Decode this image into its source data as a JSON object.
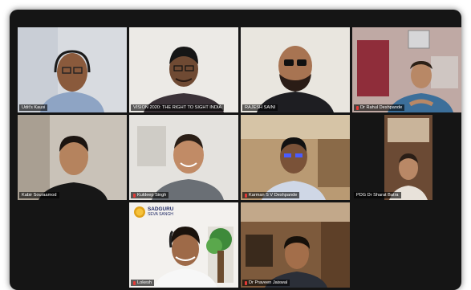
{
  "participants": [
    {
      "name": "Udit's Kausi",
      "mic_muted": false,
      "active": false
    },
    {
      "name": "VISION 2020: THE RIGHT TO SIGHT INDIA",
      "mic_muted": false,
      "active": false
    },
    {
      "name": "RAJESH SAINI",
      "mic_muted": false,
      "active": true
    },
    {
      "name": "Dr Rahul Deshpande",
      "mic_muted": true,
      "active": false
    },
    {
      "name": "Kabir Souraamod",
      "mic_muted": false,
      "active": false
    },
    {
      "name": "Kuldeep Singh",
      "mic_muted": true,
      "active": false
    },
    {
      "name": "Karman S V Deshpande",
      "mic_muted": true,
      "active": false
    },
    {
      "name": "PDG Dr Sharat Batra",
      "mic_muted": false,
      "active": false
    },
    {
      "name": "Lokesh",
      "mic_muted": true,
      "active": false
    },
    {
      "name": "Dr Praveen Jaiswal",
      "mic_muted": true,
      "active": false
    }
  ],
  "virtual_background_logo": {
    "line1": "SADGURU",
    "line2": "SEVA SANGH"
  },
  "colors": {
    "active_speaker_border": "#d9f26a",
    "muted_mic": "#e53935",
    "window_bg": "#151515"
  }
}
